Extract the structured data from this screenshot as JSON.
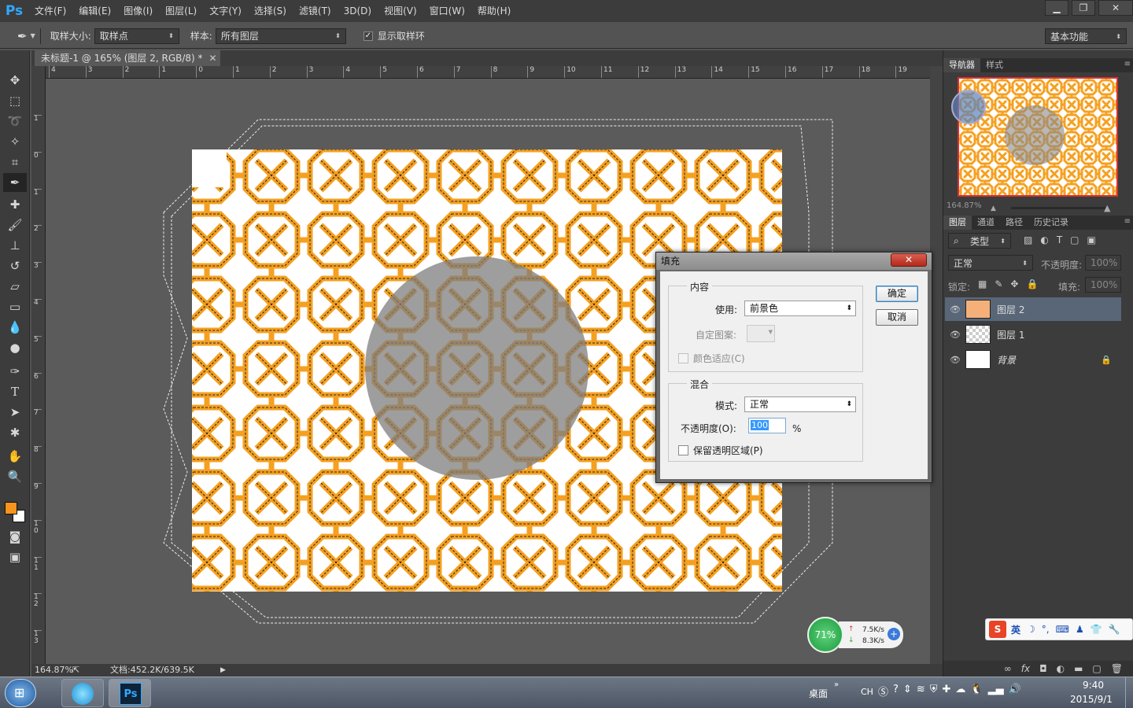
{
  "menubar": {
    "logo": "Ps",
    "items": [
      "文件(F)",
      "编辑(E)",
      "图像(I)",
      "图层(L)",
      "文字(Y)",
      "选择(S)",
      "滤镜(T)",
      "3D(D)",
      "视图(V)",
      "窗口(W)",
      "帮助(H)"
    ]
  },
  "options": {
    "sample_size_label": "取样大小:",
    "sample_size_value": "取样点",
    "sample_label": "样本:",
    "sample_value": "所有图层",
    "show_ring_label": "显示取样环",
    "show_ring_checked": true,
    "workspace": "基本功能"
  },
  "document": {
    "tab_title": "未标题-1 @ 165% (图层 2, RGB/8) *",
    "zoom": "164.87%",
    "doc_info": "文档:452.2K/639.5K"
  },
  "rulers": {
    "h_ticks": [
      "4",
      "3",
      "2",
      "1",
      "0",
      "1",
      "2",
      "3",
      "4",
      "5",
      "6",
      "7",
      "8",
      "9",
      "10",
      "11",
      "12",
      "13",
      "14",
      "15",
      "16",
      "17",
      "18",
      "19"
    ],
    "v_ticks": [
      "1",
      "0",
      "1",
      "2",
      "3",
      "4",
      "5",
      "6",
      "7",
      "8",
      "9",
      "1 0",
      "1 1",
      "1 2",
      "1 3"
    ]
  },
  "navigator": {
    "tabs": [
      "导航器",
      "样式"
    ],
    "zoom": "164.87%"
  },
  "layers_panel": {
    "tabs": [
      "图层",
      "通道",
      "路径",
      "历史记录"
    ],
    "filter_label": "类型",
    "blend_mode": "正常",
    "opacity_label": "不透明度:",
    "opacity_value": "100%",
    "lock_label": "锁定:",
    "fill_label": "填充:",
    "fill_value": "100%",
    "layers": [
      {
        "name": "图层 2",
        "selected": true,
        "locked": false
      },
      {
        "name": "图层 1",
        "selected": false,
        "locked": false
      },
      {
        "name": "背景",
        "selected": false,
        "locked": true
      }
    ]
  },
  "fill_dialog": {
    "title": "填充",
    "close": "✕",
    "content_group": "内容",
    "use_label": "使用:",
    "use_value": "前景色",
    "custom_pattern_label": "自定图案:",
    "color_adapt_label": "颜色适应(C)",
    "blend_group": "混合",
    "mode_label": "模式:",
    "mode_value": "正常",
    "opacity_label": "不透明度(O):",
    "opacity_value": "100",
    "opacity_unit": "%",
    "preserve_label": "保留透明区域(P)",
    "ok_label": "确定",
    "cancel_label": "取消"
  },
  "net_widget": {
    "percent": "71%",
    "up": "7.5K/s",
    "down": "8.3K/s"
  },
  "ime": {
    "lang": "英"
  },
  "taskbar": {
    "desktop_label": "桌面",
    "lang": "CH",
    "time": "9:40",
    "date": "2015/9/1"
  },
  "colors": {
    "foreground": "#f7941d",
    "background": "#ffffff",
    "pattern_orange": "#f5a021",
    "selected_layer": "#596678"
  }
}
